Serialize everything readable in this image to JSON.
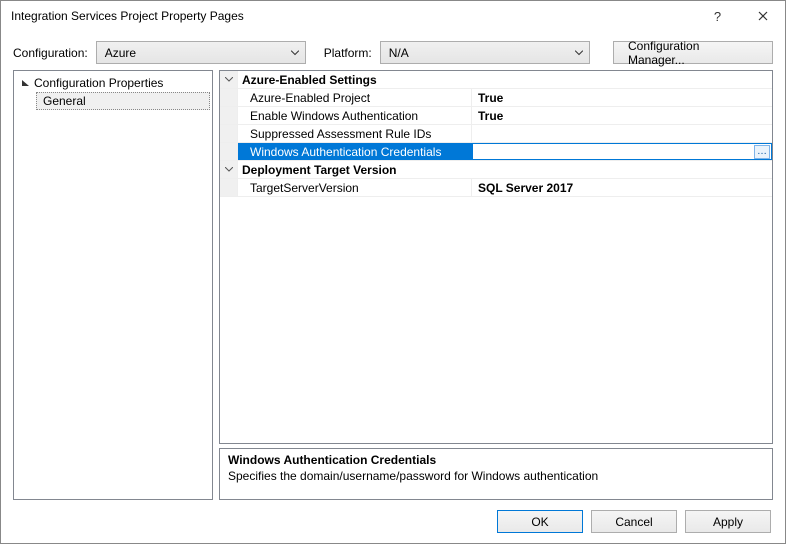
{
  "window": {
    "title": "Integration Services Project Property Pages"
  },
  "configRow": {
    "configLabel": "Configuration:",
    "configValue": "Azure",
    "platformLabel": "Platform:",
    "platformValue": "N/A",
    "managerButton": "Configuration Manager..."
  },
  "tree": {
    "root": "Configuration Properties",
    "child": "General"
  },
  "propGrid": {
    "cat1": "Azure-Enabled Settings",
    "rows1": [
      {
        "name": "Azure-Enabled Project",
        "value": "True",
        "selected": false
      },
      {
        "name": "Enable Windows Authentication",
        "value": "True",
        "selected": false
      },
      {
        "name": "Suppressed Assessment Rule IDs",
        "value": "",
        "selected": false
      },
      {
        "name": "Windows Authentication Credentials",
        "value": "",
        "selected": true
      }
    ],
    "cat2": "Deployment Target Version",
    "rows2": [
      {
        "name": "TargetServerVersion",
        "value": "SQL Server 2017",
        "selected": false
      }
    ]
  },
  "description": {
    "title": "Windows Authentication Credentials",
    "body": "Specifies the domain/username/password for Windows authentication"
  },
  "buttons": {
    "ok": "OK",
    "cancel": "Cancel",
    "apply": "Apply"
  }
}
